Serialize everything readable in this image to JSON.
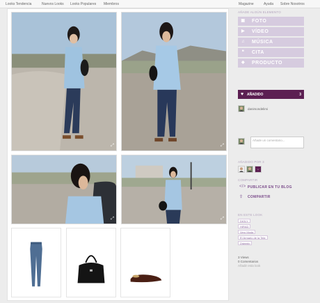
{
  "top_nav": {
    "left": [
      "Looks Tendencia",
      "Nuevos Looks",
      "Looks Populares",
      "Miembros"
    ],
    "right": [
      "Magazine",
      "Ayuda",
      "Sobre Nosotros"
    ]
  },
  "sidebar": {
    "add_title": "AÑADE ALGÚN ELEMENTO",
    "add_items": [
      {
        "label": "FOTO",
        "icon": "camera-icon"
      },
      {
        "label": "VÍDEO",
        "icon": "video-icon"
      },
      {
        "label": "MÚSICA",
        "icon": "headphones-icon"
      },
      {
        "label": "CITA",
        "icon": "quote-icon"
      },
      {
        "label": "PRODUCTO",
        "icon": "tag-icon"
      }
    ],
    "liked_label": "AÑADIDO",
    "liked_count": "3",
    "comment_user": "danimondelimi",
    "comment_placeholder": "Añade un comentario...",
    "added_by_title": "AÑADIDO POR 3",
    "share_title": "COMPARTIR",
    "share_items": [
      {
        "label": "PUBLICAR EN TU BLOG",
        "icon": "code-icon"
      },
      {
        "label": "COMPARTIR",
        "icon": "share-icon"
      }
    ],
    "tags_title": "EN ESTE LOOK",
    "tags": [
      "DIOLY",
      "HIRAD",
      "Vero Moda",
      "El Armario de la Tele",
      "Zalando"
    ],
    "stats": [
      "3 Views",
      "0 Comentarios",
      "Añadir esta look"
    ]
  }
}
